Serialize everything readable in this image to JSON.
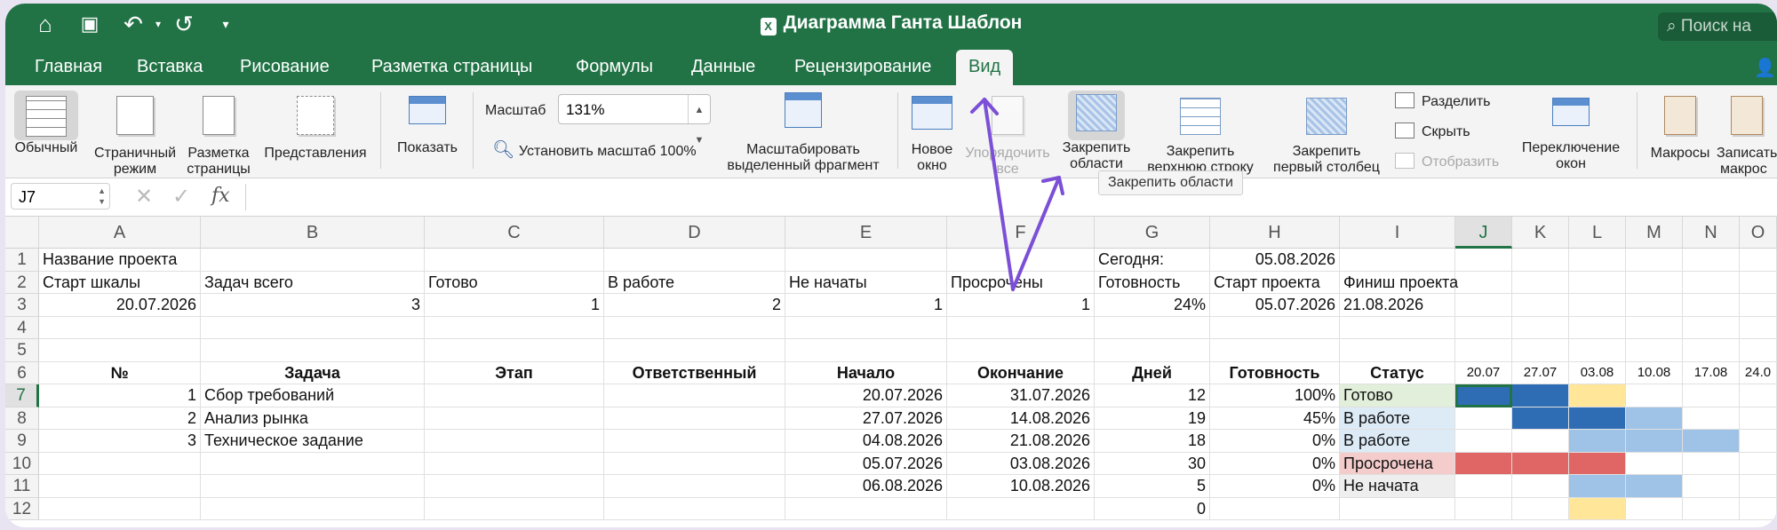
{
  "window": {
    "title": "Диаграмма Ганта Шаблон",
    "search_placeholder": "Поиск на"
  },
  "quick_access": {
    "home_icon": "home-icon",
    "save_icon": "save-icon",
    "undo_icon": "undo-icon",
    "redo_icon": "redo-icon",
    "more_icon": "more-icon"
  },
  "tabs": [
    {
      "label": "Главная"
    },
    {
      "label": "Вставка"
    },
    {
      "label": "Рисование"
    },
    {
      "label": "Разметка страницы"
    },
    {
      "label": "Формулы"
    },
    {
      "label": "Данные"
    },
    {
      "label": "Рецензирование"
    },
    {
      "label": "Вид",
      "active": true
    }
  ],
  "ribbon": {
    "normal": {
      "l1": "Обычный",
      "l2": ""
    },
    "page_break": {
      "l1": "Страничный",
      "l2": "режим"
    },
    "page_layout": {
      "l1": "Разметка",
      "l2": "страницы"
    },
    "views": {
      "l1": "Представления",
      "l2": ""
    },
    "show": {
      "l1": "Показать",
      "l2": ""
    },
    "zoom_label": "Масштаб",
    "zoom_value": "131%",
    "zoom_100": "Установить масштаб 100%",
    "zoom_selection": {
      "l1": "Масштабировать",
      "l2": "выделенный фрагмент"
    },
    "new_window": {
      "l1": "Новое",
      "l2": "окно"
    },
    "arrange_all": {
      "l1": "Упорядочить",
      "l2": "все"
    },
    "freeze_panes": {
      "l1": "Закрепить",
      "l2": "области"
    },
    "freeze_top_row": {
      "l1": "Закрепить",
      "l2": "верхнюю строку"
    },
    "freeze_first_col": {
      "l1": "Закрепить",
      "l2": "первый столбец"
    },
    "split": "Разделить",
    "hide": "Скрыть",
    "unhide": "Отобразить",
    "switch_windows": {
      "l1": "Переключение",
      "l2": "окон"
    },
    "macros": {
      "l1": "Макросы",
      "l2": ""
    },
    "record_macro": {
      "l1": "Записать",
      "l2": "макрос"
    },
    "tooltip": "Закрепить области"
  },
  "formula_bar": {
    "name_box": "J7",
    "cancel": "✕",
    "enter": "✓",
    "fx": "fx",
    "value": ""
  },
  "columns": [
    "A",
    "B",
    "C",
    "D",
    "E",
    "F",
    "G",
    "H",
    "I",
    "J",
    "K",
    "L",
    "M",
    "N",
    "O"
  ],
  "rows": [
    "1",
    "2",
    "3",
    "4",
    "5",
    "6",
    "7",
    "8",
    "9",
    "10",
    "11",
    "12"
  ],
  "cells": {
    "r1": {
      "A": "Название проекта",
      "G": "Сегодня:",
      "H": "05.08.2026"
    },
    "r2": {
      "A": "Старт шкалы",
      "B": "Задач всего",
      "C": "Готово",
      "D": "В работе",
      "E": "Не начаты",
      "F": "Просрочены",
      "G": "Готовность",
      "H": "Старт проекта",
      "I": "Финиш проекта"
    },
    "r3": {
      "A": "20.07.2026",
      "B": "3",
      "C": "1",
      "D": "2",
      "E": "1",
      "F": "1",
      "G": "24%",
      "H": "05.07.2026",
      "I": "21.08.2026"
    },
    "r6": {
      "A": "№",
      "B": "Задача",
      "C": "Этап",
      "D": "Ответственный",
      "E": "Начало",
      "F": "Окончание",
      "G": "Дней",
      "H": "Готовность",
      "I": "Статус",
      "J": "20.07",
      "K": "27.07",
      "L": "03.08",
      "M": "10.08",
      "N": "17.08",
      "O": "24.0"
    },
    "r7": {
      "A": "1",
      "B": "Сбор требований",
      "E": "20.07.2026",
      "F": "31.07.2026",
      "G": "12",
      "H": "100%",
      "I": "Готово"
    },
    "r8": {
      "A": "2",
      "B": "Анализ рынка",
      "E": "27.07.2026",
      "F": "14.08.2026",
      "G": "19",
      "H": "45%",
      "I": "В работе"
    },
    "r9": {
      "A": "3",
      "B": "Техническое задание",
      "E": "04.08.2026",
      "F": "21.08.2026",
      "G": "18",
      "H": "0%",
      "I": "В работе"
    },
    "r10": {
      "E": "05.07.2026",
      "F": "03.08.2026",
      "G": "30",
      "H": "0%",
      "I": "Просрочена"
    },
    "r11": {
      "E": "06.08.2026",
      "F": "10.08.2026",
      "G": "5",
      "H": "0%",
      "I": "Не начата"
    },
    "r12": {
      "G": "0"
    }
  },
  "colors": {
    "brand": "#217346",
    "done_fill": "#2e6db4",
    "progress_fill": "#9fc2e7",
    "overdue_fill": "#e06666",
    "today_fill": "#ffe699",
    "annotation": "#7b4fd6",
    "status_done": "#e2efda",
    "status_work": "#ddebf7",
    "status_overdue": "#f4cccc",
    "status_notstarted": "#eeeeee"
  }
}
